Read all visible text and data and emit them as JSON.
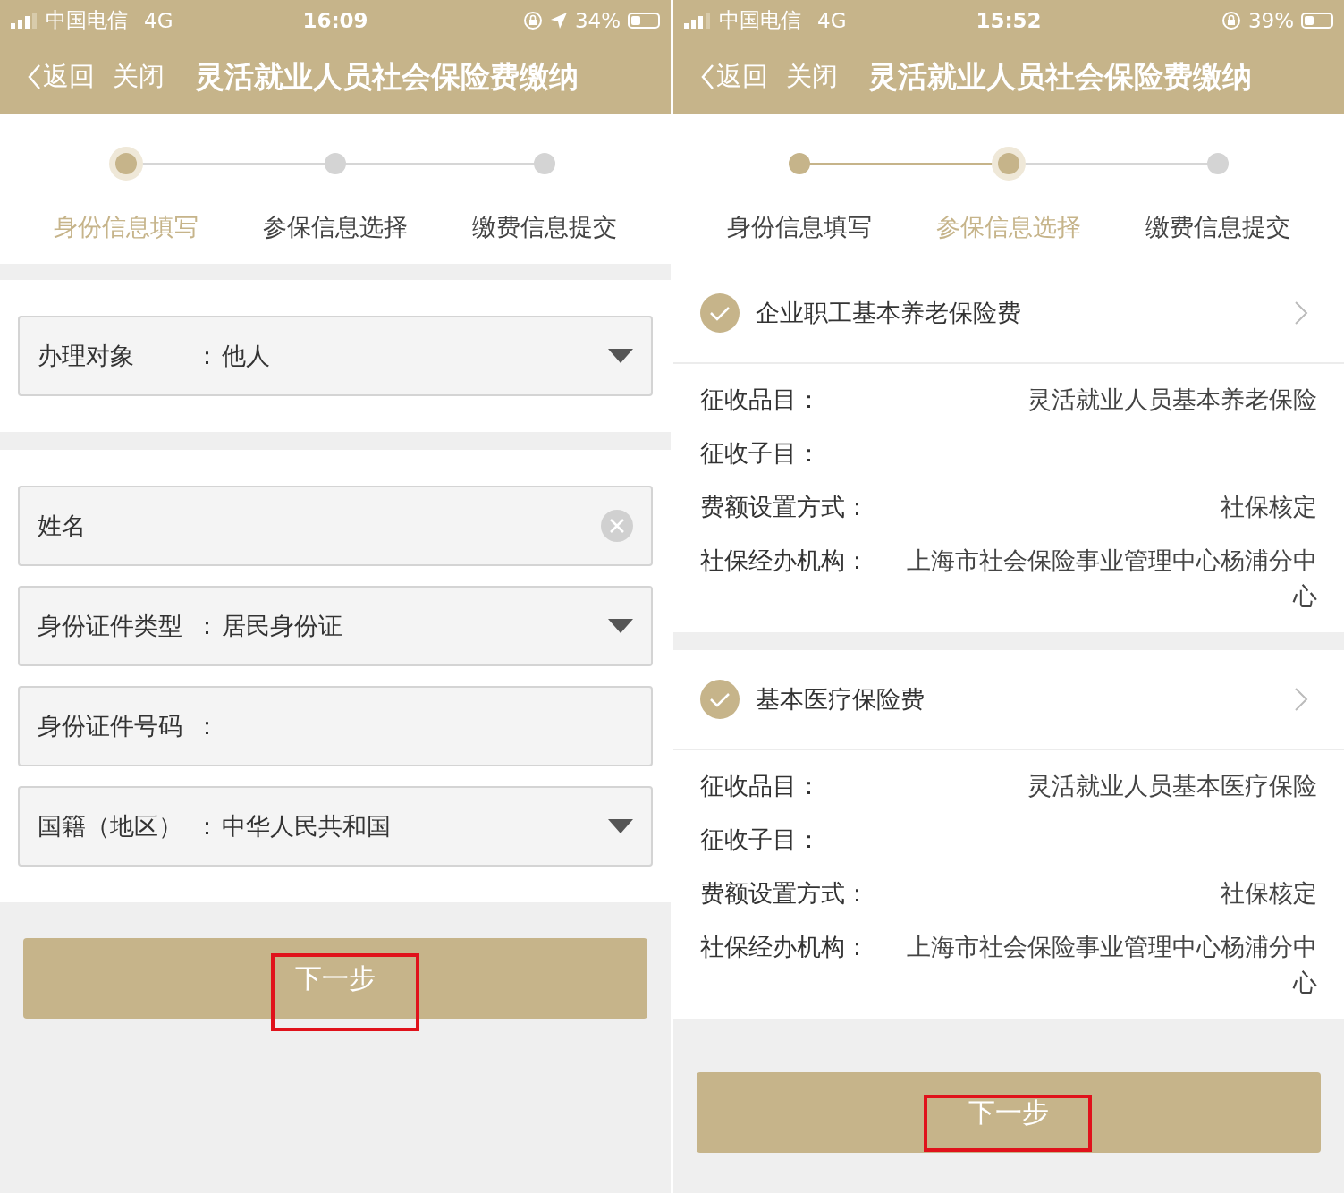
{
  "phones": [
    {
      "status_bar": {
        "carrier": "中国电信",
        "network": "4G",
        "time": "16:09",
        "battery": "34%",
        "location": true
      },
      "nav": {
        "back": "返回",
        "close": "关闭",
        "title": "灵活就业人员社会保险费缴纳"
      },
      "steps": [
        {
          "label": "身份信息填写",
          "selected": true
        },
        {
          "label": "参保信息选择",
          "selected": false
        },
        {
          "label": "缴费信息提交",
          "selected": false
        }
      ],
      "content": {
        "kind": "form",
        "sections": [
          {
            "fields": [
              {
                "kind": "select",
                "label": "办理对象",
                "sep": "：",
                "value": "他人"
              }
            ]
          },
          {
            "fields": [
              {
                "kind": "text",
                "label": "姓名",
                "clearable": true
              },
              {
                "kind": "select",
                "label": "身份证件类型",
                "sep": "：",
                "value": "居民身份证"
              },
              {
                "kind": "text",
                "label": "身份证件号码",
                "sep": "："
              },
              {
                "kind": "select",
                "label": "国籍（地区）",
                "sep": "：",
                "value": "中华人民共和国"
              }
            ]
          }
        ]
      },
      "button": {
        "label": "下一步",
        "highlighted": true
      }
    },
    {
      "status_bar": {
        "carrier": "中国电信",
        "network": "4G",
        "time": "15:52",
        "battery": "39%",
        "location": false
      },
      "nav": {
        "back": "返回",
        "close": "关闭",
        "title": "灵活就业人员社会保险费缴纳"
      },
      "steps": [
        {
          "label": "身份信息填写",
          "selected": false
        },
        {
          "label": "参保信息选择",
          "selected": true
        },
        {
          "label": "缴费信息提交",
          "selected": false
        }
      ],
      "content": {
        "kind": "cards",
        "cards": [
          {
            "title": "企业职工基本养老保险费",
            "checked": true,
            "rows": [
              {
                "label": "征收品目：",
                "value": "灵活就业人员基本养老保险"
              },
              {
                "label": "征收子目："
              },
              {
                "label": "费额设置方式：",
                "value": "社保核定"
              },
              {
                "label": "社保经办机构：",
                "value": "上海市社会保险事业管理中心杨浦分中心"
              }
            ]
          },
          {
            "title": "基本医疗保险费",
            "checked": true,
            "rows": [
              {
                "label": "征收品目：",
                "value": "灵活就业人员基本医疗保险"
              },
              {
                "label": "征收子目："
              },
              {
                "label": "费额设置方式：",
                "value": "社保核定"
              },
              {
                "label": "社保经办机构：",
                "value": "上海市社会保险事业管理中心杨浦分中心"
              }
            ]
          }
        ]
      },
      "button": {
        "label": "下一步",
        "highlighted": true
      }
    }
  ]
}
